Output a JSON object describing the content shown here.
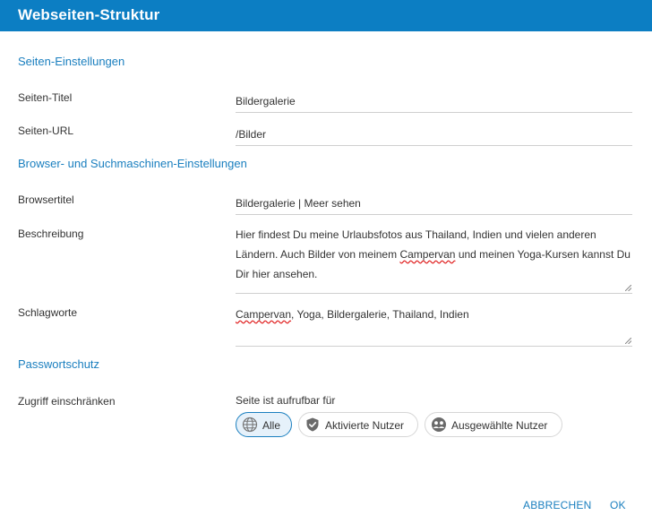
{
  "dialog": {
    "title": "Webseiten-Struktur"
  },
  "page_settings": {
    "section_title": "Seiten-Einstellungen",
    "page_title_label": "Seiten-Titel",
    "page_title_value": "Bildergalerie",
    "page_url_label": "Seiten-URL",
    "page_url_value": "/Bilder"
  },
  "browser_settings": {
    "section_title": "Browser- und Suchmaschinen-Einstellungen",
    "browser_title_label": "Browsertitel",
    "browser_title_value": "Bildergalerie | Meer sehen",
    "description_label": "Beschreibung",
    "description_part1": "Hier findest Du meine Urlaubsfotos aus Thailand, Indien und vielen anderen Ländern. Auch Bilder von meinem ",
    "description_spell_word": "Campervan",
    "description_part2": " und meinen Yoga-Kursen kannst Du Dir hier ansehen.",
    "keywords_label": "Schlagworte",
    "keywords_spell_word": "Campervan",
    "keywords_rest": ", Yoga, Bildergalerie, Thailand, Indien"
  },
  "password_protection": {
    "section_title": "Passwortschutz",
    "restrict_label": "Zugriff einschränken",
    "access_caption": "Seite ist aufrufbar für",
    "options": [
      {
        "label": "Alle",
        "icon": "globe-icon",
        "selected": true
      },
      {
        "label": "Aktivierte Nutzer",
        "icon": "shield-check-icon",
        "selected": false
      },
      {
        "label": "Ausgewählte Nutzer",
        "icon": "user-group-icon",
        "selected": false
      }
    ]
  },
  "footer": {
    "cancel_label": "ABBRECHEN",
    "ok_label": "OK"
  },
  "colors": {
    "header_bg": "#0c7ec3",
    "accent": "#1a7fbf",
    "selected_bg": "#e6f1fa",
    "spellcheck": "#e02020"
  }
}
